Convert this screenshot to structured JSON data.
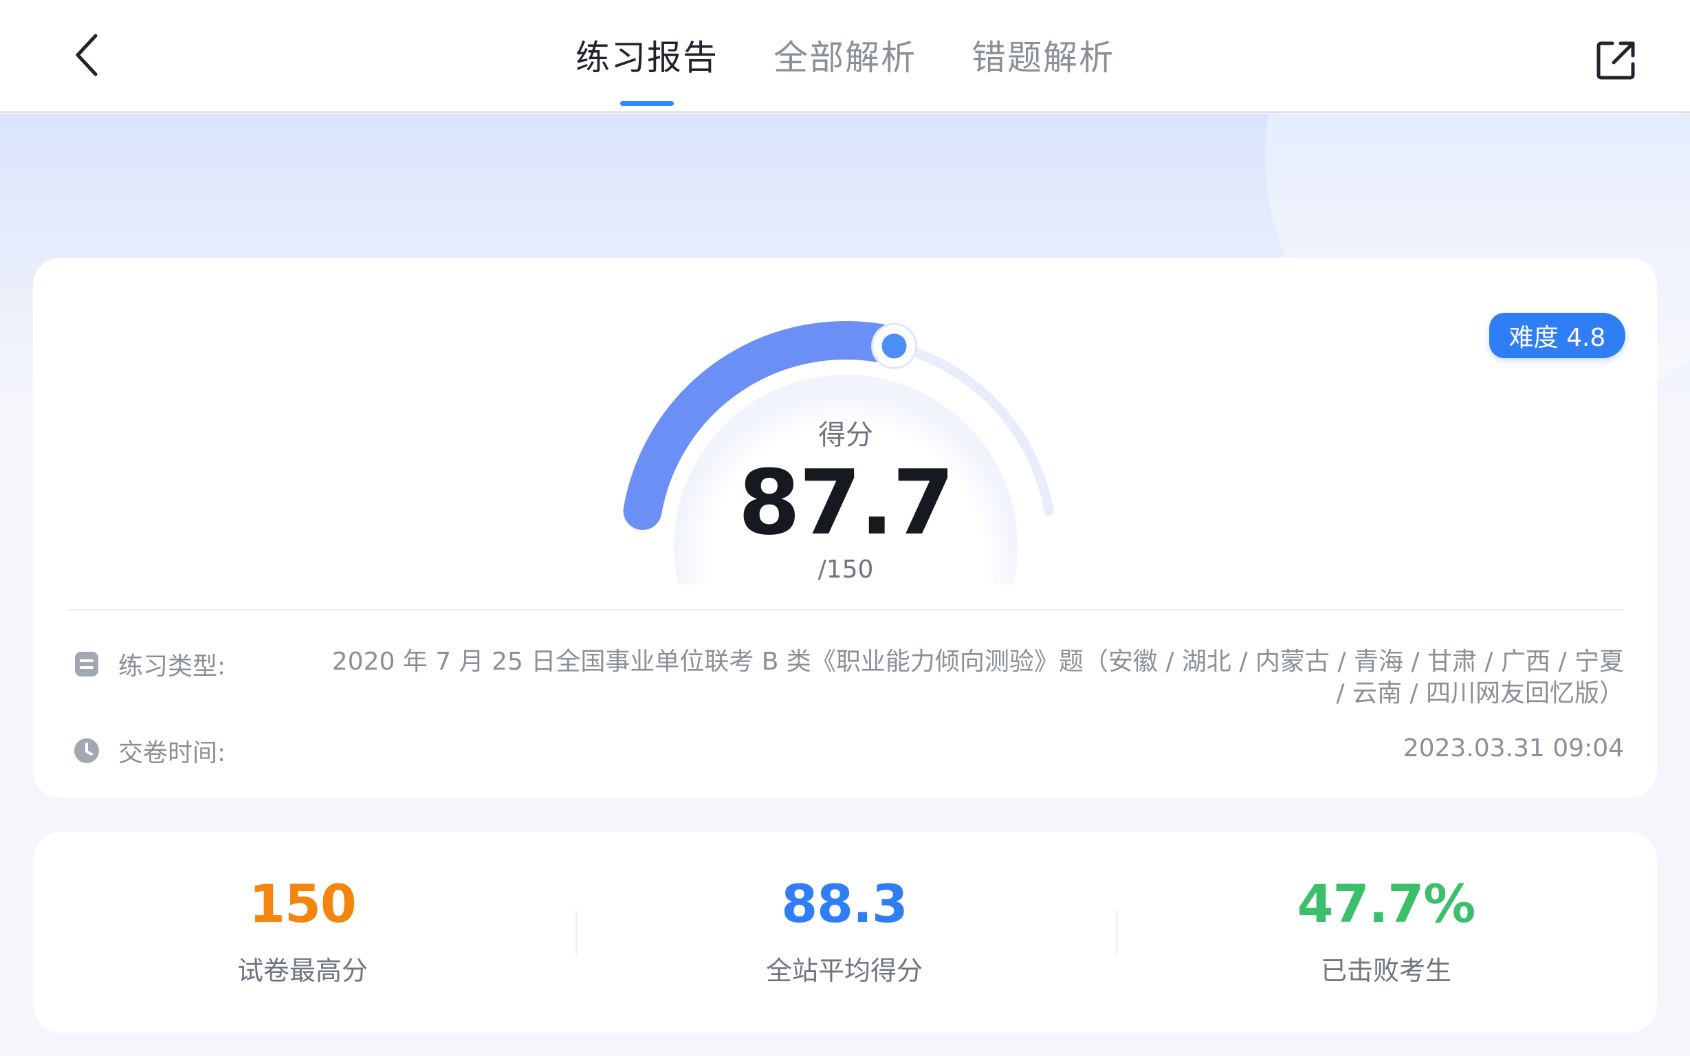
{
  "header": {
    "tabs": [
      {
        "label": "练习报告",
        "active": true
      },
      {
        "label": "全部解析",
        "active": false
      },
      {
        "label": "错题解析",
        "active": false
      }
    ],
    "back_icon": "chevron-left-icon",
    "share_icon": "share-external-icon"
  },
  "report": {
    "difficulty_badge": "难度 4.8",
    "score_label": "得分",
    "score_value": "87.7",
    "score_total": "/150",
    "score_fraction": 0.585,
    "info": {
      "type_label": "练习类型:",
      "type_value": "2020 年 7 月 25 日全国事业单位联考 B 类《职业能力倾向测验》题（安徽 / 湖北 / 内蒙古 / 青海 / 甘肃 / 广西 / 宁夏 / 云南 / 四川网友回忆版）",
      "time_label": "交卷时间:",
      "time_value": "2023.03.31 09:04"
    }
  },
  "stats": [
    {
      "value": "150",
      "caption": "试卷最高分",
      "color": "#f5850f"
    },
    {
      "value": "88.3",
      "caption": "全站平均得分",
      "color": "#2f7ef6"
    },
    {
      "value": "47.7%",
      "caption": "已击败考生",
      "color": "#3cbf6a"
    }
  ],
  "colors": {
    "accent": "#2f8bf7",
    "gauge_track": "#e8ecfb",
    "gauge_fill": "#6a8ff5"
  }
}
